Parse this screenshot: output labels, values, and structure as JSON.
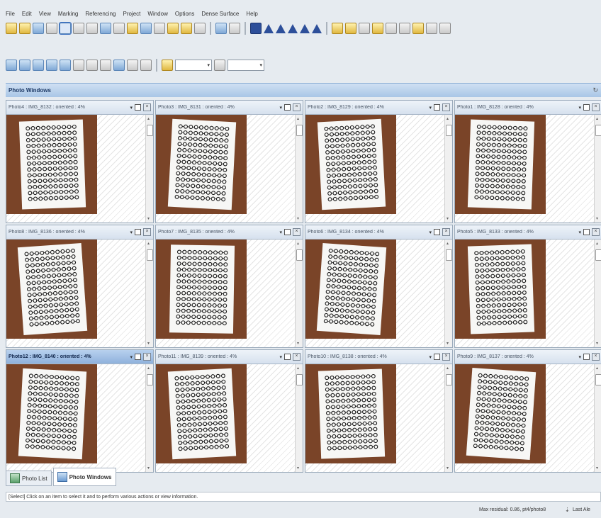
{
  "menu": [
    "File",
    "Edit",
    "View",
    "Marking",
    "Referencing",
    "Project",
    "Window",
    "Options",
    "Dense Surface",
    "Help"
  ],
  "toolbar1": {
    "icons": [
      "new-icon",
      "open-icon",
      "save-icon",
      "undo-icon",
      "select-icon",
      "zoom-icon",
      "marker-icon",
      "point-icon",
      "line-icon",
      "curve-icon",
      "move-icon",
      "pen-icon",
      "tool-icon",
      "camera-icon",
      "settings-icon",
      "grid-icon",
      "wand-icon"
    ]
  },
  "toolbar2": {
    "icons": [
      "photo-icon",
      "photo2-icon",
      "photo3-icon",
      "photo4-icon",
      "photo5-icon",
      "view-icon",
      "table-icon",
      "ruler-icon",
      "zoom-in-icon",
      "fit-icon",
      "grid-view-icon"
    ],
    "combo1_value": "",
    "combo2_value": ""
  },
  "photo_windows": {
    "title": "Photo Windows",
    "panes": [
      {
        "label": "Photo4 : IMG_8132 : oriented : 4%",
        "active": false
      },
      {
        "label": "Photo3 : IMG_8131 : oriented : 4%",
        "active": false
      },
      {
        "label": "Photo2 : IMG_8129 : oriented : 4%",
        "active": false
      },
      {
        "label": "Photo1 : IMG_8128 : oriented : 4%",
        "active": false
      },
      {
        "label": "Photo8 : IMG_8136 : oriented : 4%",
        "active": false
      },
      {
        "label": "Photo7 : IMG_8135 : oriented : 4%",
        "active": false
      },
      {
        "label": "Photo6 : IMG_8134 : oriented : 4%",
        "active": false
      },
      {
        "label": "Photo5 : IMG_8133 : oriented : 4%",
        "active": false
      },
      {
        "label": "Photo12 : IMG_8140 : oriented : 4%",
        "active": true
      },
      {
        "label": "Photo11 : IMG_8139 : oriented : 4%",
        "active": false
      },
      {
        "label": "Photo10 : IMG_8138 : oriented : 4%",
        "active": false
      },
      {
        "label": "Photo9 : IMG_8137 : oriented : 4%",
        "active": false
      }
    ]
  },
  "tabs": [
    {
      "label": "Photo List",
      "active": false
    },
    {
      "label": "Photo Windows",
      "active": true
    }
  ],
  "status_text": "[Select] Click on an item to select it and to perform various actions or view information.",
  "footer": {
    "residual": "Max residual: 0.86, pt4/photo8",
    "last": "Last Ale"
  }
}
